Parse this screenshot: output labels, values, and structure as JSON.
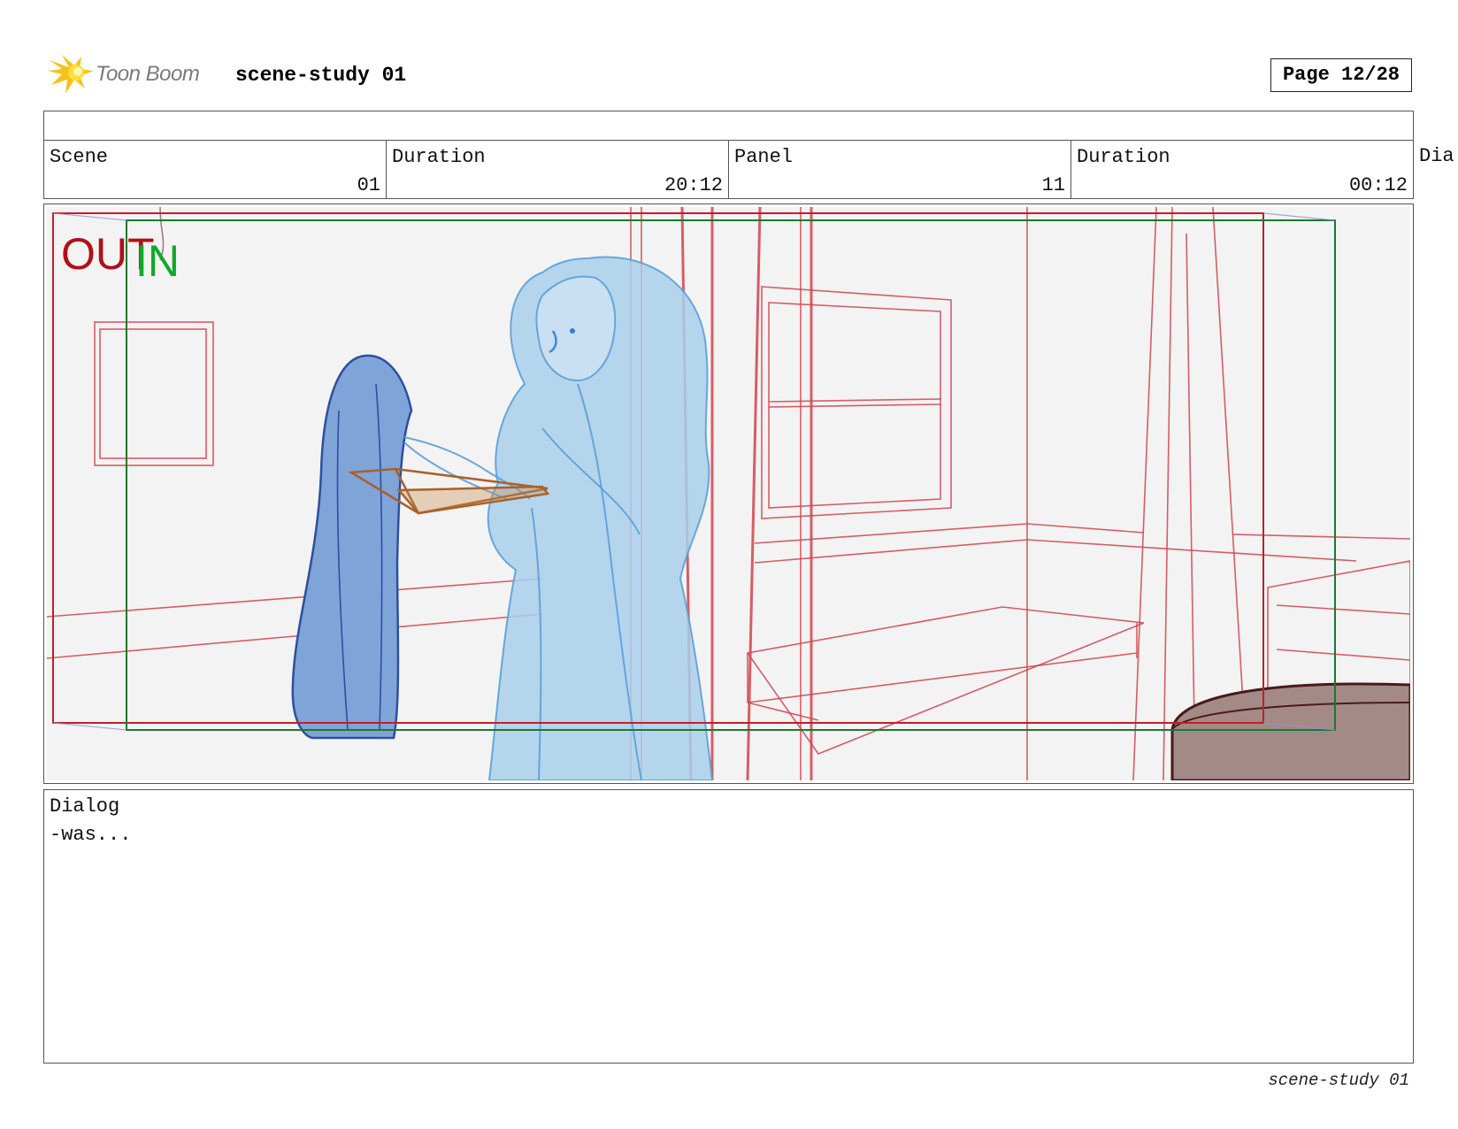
{
  "header": {
    "logo_text": "Toon Boom",
    "project_title": "scene-study 01",
    "page_label": "Page 12/28"
  },
  "info": {
    "scene_label": "Scene",
    "scene_value": "01",
    "scene_duration_label": "Duration",
    "scene_duration_value": "20:12",
    "panel_label": "Panel",
    "panel_value": "11",
    "panel_duration_label": "Duration",
    "panel_duration_value": "00:12",
    "dialog_label_cut": "Dia"
  },
  "frame": {
    "out_label": "OUT",
    "in_label": "IN",
    "colors": {
      "out_frame": "#c0202a",
      "in_frame": "#1a7a2a",
      "background_lines": "#d0424c",
      "character_light": "#9cc8e8",
      "character_dark": "#6e9bd6",
      "coat_stroke": "#2d4fa0",
      "book": "#a8622a",
      "barrel": "#a48a86"
    }
  },
  "dialog": {
    "label": "Dialog",
    "text": "-was..."
  },
  "footer": {
    "text": "scene-study 01"
  }
}
